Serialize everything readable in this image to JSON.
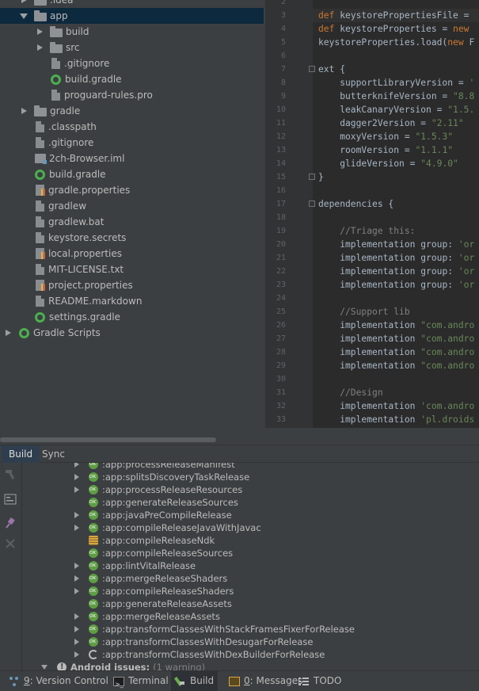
{
  "project_tree": {
    "rows": [
      {
        "label": ".idea",
        "depth": 1,
        "arrow": "right",
        "icon": "folder-icon",
        "selected": false
      },
      {
        "label": "app",
        "depth": 1,
        "arrow": "down",
        "icon": "folder-icon",
        "selected": true
      },
      {
        "label": "build",
        "depth": 2,
        "arrow": "right",
        "icon": "folder-icon",
        "selected": false
      },
      {
        "label": "src",
        "depth": 2,
        "arrow": "right",
        "icon": "folder-icon",
        "selected": false
      },
      {
        "label": ".gitignore",
        "depth": 2,
        "arrow": "none",
        "icon": "file-icon",
        "selected": false
      },
      {
        "label": "build.gradle",
        "depth": 2,
        "arrow": "none",
        "icon": "gradle-icon",
        "selected": false
      },
      {
        "label": "proguard-rules.pro",
        "depth": 2,
        "arrow": "none",
        "icon": "file-icon",
        "selected": false
      },
      {
        "label": "gradle",
        "depth": 1,
        "arrow": "right",
        "icon": "folder-icon",
        "selected": false
      },
      {
        "label": ".classpath",
        "depth": 1,
        "arrow": "none",
        "icon": "file-icon",
        "selected": false
      },
      {
        "label": ".gitignore",
        "depth": 1,
        "arrow": "none",
        "icon": "file-icon",
        "selected": false
      },
      {
        "label": "2ch-Browser.iml",
        "depth": 1,
        "arrow": "none",
        "icon": "iml-icon",
        "selected": false
      },
      {
        "label": "build.gradle",
        "depth": 1,
        "arrow": "none",
        "icon": "gradle-icon",
        "selected": false
      },
      {
        "label": "gradle.properties",
        "depth": 1,
        "arrow": "none",
        "icon": "props-icon",
        "selected": false
      },
      {
        "label": "gradlew",
        "depth": 1,
        "arrow": "none",
        "icon": "file-icon",
        "selected": false
      },
      {
        "label": "gradlew.bat",
        "depth": 1,
        "arrow": "none",
        "icon": "file-icon",
        "selected": false
      },
      {
        "label": "keystore.secrets",
        "depth": 1,
        "arrow": "none",
        "icon": "file-icon",
        "selected": false
      },
      {
        "label": "local.properties",
        "depth": 1,
        "arrow": "none",
        "icon": "props-icon",
        "selected": false
      },
      {
        "label": "MIT-LICENSE.txt",
        "depth": 1,
        "arrow": "none",
        "icon": "file-icon",
        "selected": false
      },
      {
        "label": "project.properties",
        "depth": 1,
        "arrow": "none",
        "icon": "props-icon",
        "selected": false
      },
      {
        "label": "README.markdown",
        "depth": 1,
        "arrow": "none",
        "icon": "file-icon",
        "selected": false
      },
      {
        "label": "settings.gradle",
        "depth": 1,
        "arrow": "none",
        "icon": "gradle-icon",
        "selected": false
      },
      {
        "label": "Gradle Scripts",
        "depth": 0,
        "arrow": "right",
        "icon": "gradle-icon",
        "selected": false
      }
    ]
  },
  "editor": {
    "lines": [
      {
        "n": "2",
        "fold": false,
        "tokens": []
      },
      {
        "n": "3",
        "fold": false,
        "tokens": [
          {
            "t": "def ",
            "c": "kw"
          },
          {
            "t": "keystorePropertiesFile = ",
            "c": ""
          }
        ]
      },
      {
        "n": "4",
        "fold": false,
        "tokens": [
          {
            "t": "def ",
            "c": "kw"
          },
          {
            "t": "keystoreProperties = ",
            "c": ""
          },
          {
            "t": "new",
            "c": "kw"
          }
        ]
      },
      {
        "n": "5",
        "fold": false,
        "tokens": [
          {
            "t": "keystoreProperties.load(",
            "c": ""
          },
          {
            "t": "new ",
            "c": "kw"
          },
          {
            "t": "F",
            "c": ""
          }
        ]
      },
      {
        "n": "6",
        "fold": false,
        "tokens": []
      },
      {
        "n": "7",
        "fold": true,
        "tokens": [
          {
            "t": "ext {",
            "c": ""
          }
        ]
      },
      {
        "n": "8",
        "fold": false,
        "tokens": [
          {
            "t": "    supportLibraryVersion = ",
            "c": ""
          },
          {
            "t": "'",
            "c": "str"
          }
        ]
      },
      {
        "n": "9",
        "fold": false,
        "tokens": [
          {
            "t": "    butterknifeVersion = ",
            "c": ""
          },
          {
            "t": "\"8.8",
            "c": "str"
          }
        ]
      },
      {
        "n": "10",
        "fold": false,
        "tokens": [
          {
            "t": "    leakCanaryVersion = ",
            "c": ""
          },
          {
            "t": "\"1.5.",
            "c": "str"
          }
        ]
      },
      {
        "n": "11",
        "fold": false,
        "tokens": [
          {
            "t": "    dagger2Version = ",
            "c": ""
          },
          {
            "t": "\"2.11\"",
            "c": "str"
          }
        ]
      },
      {
        "n": "12",
        "fold": false,
        "tokens": [
          {
            "t": "    moxyVersion = ",
            "c": ""
          },
          {
            "t": "\"1.5.3\"",
            "c": "str"
          }
        ]
      },
      {
        "n": "13",
        "fold": false,
        "tokens": [
          {
            "t": "    roomVersion = ",
            "c": ""
          },
          {
            "t": "\"1.1.1\"",
            "c": "str"
          }
        ]
      },
      {
        "n": "14",
        "fold": false,
        "tokens": [
          {
            "t": "    glideVersion = ",
            "c": ""
          },
          {
            "t": "\"4.9.0\"",
            "c": "str"
          }
        ]
      },
      {
        "n": "15",
        "fold": true,
        "tokens": [
          {
            "t": "}",
            "c": ""
          }
        ]
      },
      {
        "n": "16",
        "fold": false,
        "tokens": []
      },
      {
        "n": "17",
        "fold": true,
        "tokens": [
          {
            "t": "dependencies {",
            "c": ""
          }
        ]
      },
      {
        "n": "18",
        "fold": false,
        "tokens": []
      },
      {
        "n": "19",
        "fold": false,
        "tokens": [
          {
            "t": "    //Triage this:",
            "c": "cmt"
          }
        ]
      },
      {
        "n": "20",
        "fold": false,
        "tokens": [
          {
            "t": "    implementation ",
            "c": ""
          },
          {
            "t": "group",
            "c": ""
          },
          {
            "t": ": ",
            "c": ""
          },
          {
            "t": "'or",
            "c": "str"
          }
        ]
      },
      {
        "n": "21",
        "fold": false,
        "tokens": [
          {
            "t": "    implementation ",
            "c": ""
          },
          {
            "t": "group",
            "c": ""
          },
          {
            "t": ": ",
            "c": ""
          },
          {
            "t": "'or",
            "c": "str"
          }
        ]
      },
      {
        "n": "22",
        "fold": false,
        "tokens": [
          {
            "t": "    implementation ",
            "c": ""
          },
          {
            "t": "group",
            "c": ""
          },
          {
            "t": ": ",
            "c": ""
          },
          {
            "t": "'or",
            "c": "str"
          }
        ]
      },
      {
        "n": "23",
        "fold": false,
        "tokens": [
          {
            "t": "    implementation ",
            "c": ""
          },
          {
            "t": "group",
            "c": ""
          },
          {
            "t": ": ",
            "c": ""
          },
          {
            "t": "'or",
            "c": "str"
          }
        ]
      },
      {
        "n": "24",
        "fold": false,
        "tokens": []
      },
      {
        "n": "25",
        "fold": false,
        "tokens": [
          {
            "t": "    //Support lib",
            "c": "cmt"
          }
        ]
      },
      {
        "n": "26",
        "fold": false,
        "tokens": [
          {
            "t": "    implementation ",
            "c": ""
          },
          {
            "t": "\"com.andro",
            "c": "str"
          }
        ]
      },
      {
        "n": "27",
        "fold": false,
        "tokens": [
          {
            "t": "    implementation ",
            "c": ""
          },
          {
            "t": "\"com.andro",
            "c": "str"
          }
        ]
      },
      {
        "n": "28",
        "fold": false,
        "tokens": [
          {
            "t": "    implementation ",
            "c": ""
          },
          {
            "t": "\"com.andro",
            "c": "str"
          }
        ]
      },
      {
        "n": "29",
        "fold": false,
        "tokens": [
          {
            "t": "    implementation ",
            "c": ""
          },
          {
            "t": "\"com.andro",
            "c": "str"
          }
        ]
      },
      {
        "n": "30",
        "fold": false,
        "tokens": []
      },
      {
        "n": "31",
        "fold": false,
        "tokens": [
          {
            "t": "    //Design",
            "c": "cmt"
          }
        ]
      },
      {
        "n": "32",
        "fold": false,
        "tokens": [
          {
            "t": "    implementation ",
            "c": ""
          },
          {
            "t": "'com.andro",
            "c": "str"
          }
        ]
      },
      {
        "n": "33",
        "fold": false,
        "tokens": [
          {
            "t": "    implementation ",
            "c": ""
          },
          {
            "t": "'pl.droids",
            "c": "str"
          }
        ]
      }
    ]
  },
  "tool_window_tabs": [
    {
      "label": "Build",
      "active": true
    },
    {
      "label": "Sync",
      "active": false
    }
  ],
  "build_toolbar": [
    "hammer-icon",
    "toggle-view-icon",
    "pin-icon",
    "close-icon"
  ],
  "build_tree": {
    "tasks": [
      {
        "label": ":app:processReleaseManifest",
        "arrow": "right",
        "icon": "ok"
      },
      {
        "label": ":app:splitsDiscoveryTaskRelease",
        "arrow": "right",
        "icon": "ok"
      },
      {
        "label": ":app:processReleaseResources",
        "arrow": "right",
        "icon": "ok"
      },
      {
        "label": ":app:generateReleaseSources",
        "arrow": "none",
        "icon": "ok"
      },
      {
        "label": ":app:javaPreCompileRelease",
        "arrow": "right",
        "icon": "ok"
      },
      {
        "label": ":app:compileReleaseJavaWithJavac",
        "arrow": "right",
        "icon": "ok"
      },
      {
        "label": ":app:compileReleaseNdk",
        "arrow": "none",
        "icon": "stack"
      },
      {
        "label": ":app:compileReleaseSources",
        "arrow": "none",
        "icon": "ok"
      },
      {
        "label": ":app:lintVitalRelease",
        "arrow": "right",
        "icon": "ok"
      },
      {
        "label": ":app:mergeReleaseShaders",
        "arrow": "right",
        "icon": "ok"
      },
      {
        "label": ":app:compileReleaseShaders",
        "arrow": "right",
        "icon": "ok"
      },
      {
        "label": ":app:generateReleaseAssets",
        "arrow": "none",
        "icon": "ok"
      },
      {
        "label": ":app:mergeReleaseAssets",
        "arrow": "right",
        "icon": "ok"
      },
      {
        "label": ":app:transformClassesWithStackFramesFixerForRelease",
        "arrow": "right",
        "icon": "ok"
      },
      {
        "label": ":app:transformClassesWithDesugarForRelease",
        "arrow": "right",
        "icon": "ok"
      },
      {
        "label": ":app:transformClassesWithDexBuilderForRelease",
        "arrow": "right",
        "icon": "spin"
      }
    ],
    "issues": {
      "label": "Android issues:",
      "count": "(1 warning)"
    }
  },
  "bottom_tabs": [
    {
      "key": "version-control",
      "mnemonic": "9",
      "label": ": Version Control",
      "icon": "vc-icon",
      "active": false
    },
    {
      "key": "terminal",
      "mnemonic": "",
      "label": "Terminal",
      "icon": "term-icon",
      "active": false
    },
    {
      "key": "build",
      "mnemonic": "",
      "label": "Build",
      "icon": "build-icon",
      "active": true
    },
    {
      "key": "messages",
      "mnemonic": "0",
      "label": ": Messages",
      "icon": "msg-icon",
      "active": false
    },
    {
      "key": "todo",
      "mnemonic": "",
      "label": "TODO",
      "icon": "todo-icon",
      "active": false
    }
  ]
}
